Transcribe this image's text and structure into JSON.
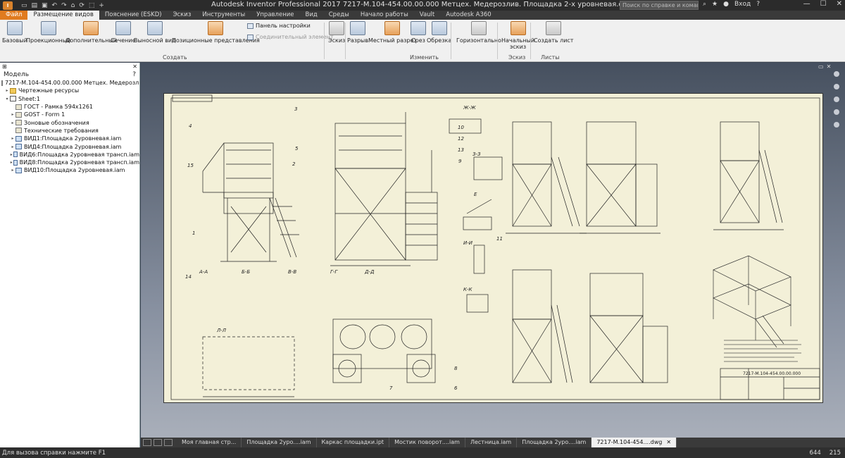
{
  "titlebar": {
    "app_icon": "I",
    "window_title": "Autodesk Inventor Professional 2017   7217-М.104-454.00.00.000 Метцех. Медерозлив. Площадка 2-х уровневая.dwg",
    "search_placeholder": "Поиск по справке и командам",
    "user": "Вход",
    "minimize": "—",
    "maximize": "☐",
    "close": "✕"
  },
  "ribbon_tabs": [
    {
      "label": "Файл"
    },
    {
      "label": "Размещение видов"
    },
    {
      "label": "Пояснение (ESKD)"
    },
    {
      "label": "Эскиз"
    },
    {
      "label": "Инструменты"
    },
    {
      "label": "Управление"
    },
    {
      "label": "Вид"
    },
    {
      "label": "Среды"
    },
    {
      "label": "Начало работы"
    },
    {
      "label": "Vault"
    },
    {
      "label": "Autodesk A360"
    }
  ],
  "ribbon": {
    "create": {
      "group_label": "Создать",
      "base": "Базовый",
      "projected": "Проекционный",
      "auxiliary": "Дополнительный",
      "section": "Сечение",
      "detail": "Выносной вид",
      "positional": "Позиционные представления",
      "overlay_panel": "Панель настройки",
      "connector": "Соединительный элемент"
    },
    "sketch_btn": "Эскиз",
    "modify": {
      "group_label": "Изменить",
      "break": "Разрыв",
      "local_section": "Местный разрез",
      "slice": "Срез",
      "crop": "Обрезка",
      "horizontal": "Горизонтально"
    },
    "sketch_group": {
      "group_label": "Эскиз",
      "start_sketch_1": "Начальный",
      "start_sketch_2": "эскиз"
    },
    "sheets_group": {
      "group_label": "Листы",
      "new_sheet": "Создать лист"
    }
  },
  "browser": {
    "title": "Модель",
    "help": "?",
    "close": "✕",
    "nodes": [
      {
        "label": "7217-М.104-454.00.00.000 Метцех. Медерозлив. Площ",
        "expander": "",
        "icon": "doc"
      },
      {
        "label": "Чертежные ресурсы",
        "expander": "▸",
        "icon": "folder"
      },
      {
        "label": "Sheet:1",
        "expander": "▾",
        "icon": "sheet"
      },
      {
        "label": "ГОСТ - Рамка 594x1261",
        "expander": "",
        "icon": "doc"
      },
      {
        "label": "GOST - Form 1",
        "expander": "▸",
        "icon": "doc"
      },
      {
        "label": "Зоновые обозначения",
        "expander": "▸",
        "icon": "doc"
      },
      {
        "label": "Технические требования",
        "expander": "",
        "icon": "doc"
      },
      {
        "label": "ВИД1:Площадка 2уровневая.iam",
        "expander": "▸",
        "icon": "view"
      },
      {
        "label": "ВИД4:Площадка 2уровневая.iam",
        "expander": "▸",
        "icon": "view"
      },
      {
        "label": "ВИД6:Площадка 2уровневая трансп.iam",
        "expander": "▸",
        "icon": "view"
      },
      {
        "label": "ВИД8:Площадка 2уровневая трансп.iam",
        "expander": "▸",
        "icon": "view"
      },
      {
        "label": "ВИД10:Площадка 2уровневая.iam",
        "expander": "▸",
        "icon": "view"
      }
    ]
  },
  "drawing": {
    "labels": {
      "aa": "А-А",
      "bb": "Б-Б",
      "vv": "В-В",
      "gg": "Г-Г",
      "dd": "Д-Д",
      "ll": "Л-Л",
      "zhzh": "Ж-Ж",
      "zz": "З-З",
      "ii": "И-И",
      "kk": "К-К",
      "e": "Е",
      "n1": "1",
      "n2": "2",
      "n3": "3",
      "n4": "4",
      "n5": "5",
      "n6": "6",
      "n7": "7",
      "n8": "8",
      "n9": "9",
      "n10": "10",
      "n11": "11",
      "n12": "12",
      "n13": "13",
      "n14": "14",
      "n15": "15"
    },
    "title_block_code": "7217-М.104-454.00.00.000"
  },
  "doc_tabs": [
    {
      "label": "Моя главная стр..."
    },
    {
      "label": "Площадка 2уро....iam"
    },
    {
      "label": "Каркас площадки.ipt"
    },
    {
      "label": "Мостик поворот....iam"
    },
    {
      "label": "Лестница.iam"
    },
    {
      "label": "Площадка 2уро....iam"
    },
    {
      "label": "7217-М.104-454....dwg",
      "close": "✕"
    }
  ],
  "statusbar": {
    "help_text": "Для вызова справки нажмите F1",
    "num1": "644",
    "num2": "215"
  },
  "colors": {
    "accent": "#e07b1f",
    "sheet_bg": "#f3f0d8",
    "ribbon_bg": "#f0f0f0"
  }
}
